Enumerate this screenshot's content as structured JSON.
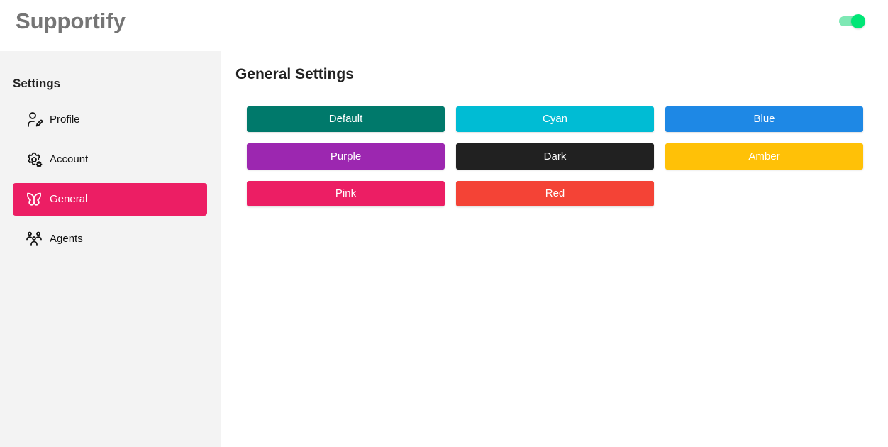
{
  "app": {
    "title": "Supportify"
  },
  "theme_toggle": {
    "state": "on",
    "color": "#00e676"
  },
  "sidebar": {
    "heading": "Settings",
    "items": [
      {
        "label": "Profile",
        "icon": "user-edit-icon",
        "active": false
      },
      {
        "label": "Account",
        "icon": "user-gear-icon",
        "active": false
      },
      {
        "label": "General",
        "icon": "butterfly-icon",
        "active": true
      },
      {
        "label": "Agents",
        "icon": "users-group-icon",
        "active": false
      }
    ],
    "active_color": "#ec1e64"
  },
  "main": {
    "title": "General Settings",
    "themes": [
      {
        "label": "Default",
        "color": "#00796b"
      },
      {
        "label": "Cyan",
        "color": "#00bcd4"
      },
      {
        "label": "Blue",
        "color": "#1e88e5"
      },
      {
        "label": "Purple",
        "color": "#9c27b0"
      },
      {
        "label": "Dark",
        "color": "#212121"
      },
      {
        "label": "Amber",
        "color": "#ffc107"
      },
      {
        "label": "Pink",
        "color": "#ec1e64"
      },
      {
        "label": "Red",
        "color": "#f44336"
      }
    ]
  }
}
